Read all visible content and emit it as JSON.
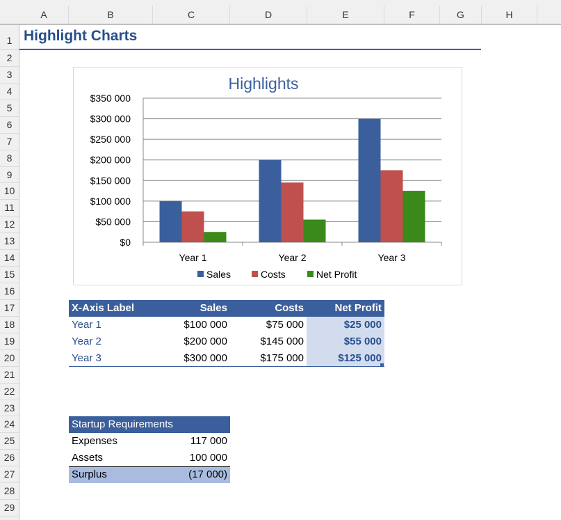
{
  "columns": [
    "A",
    "B",
    "C",
    "D",
    "E",
    "F",
    "G",
    "H"
  ],
  "rows": [
    "1",
    "2",
    "3",
    "4",
    "5",
    "6",
    "7",
    "8",
    "9",
    "10",
    "11",
    "12",
    "13",
    "14",
    "15",
    "16",
    "17",
    "18",
    "19",
    "20",
    "21",
    "22",
    "23",
    "24",
    "25",
    "26",
    "27",
    "28",
    "29"
  ],
  "title": "Highlight Charts",
  "chart_data": {
    "type": "bar",
    "title": "Highlights",
    "categories": [
      "Year 1",
      "Year 2",
      "Year 3"
    ],
    "series": [
      {
        "name": "Sales",
        "values": [
          100000,
          200000,
          300000
        ],
        "color": "#3a5f9c"
      },
      {
        "name": "Costs",
        "values": [
          75000,
          145000,
          175000
        ],
        "color": "#c0504d"
      },
      {
        "name": "Net Profit",
        "values": [
          25000,
          55000,
          125000
        ],
        "color": "#3a8a1a"
      }
    ],
    "ylim": [
      0,
      350000
    ],
    "yticks": [
      "$0",
      "$50 000",
      "$100 000",
      "$150 000",
      "$200 000",
      "$250 000",
      "$300 000",
      "$350 000"
    ],
    "legend": "bottom",
    "grid": true
  },
  "data_table": {
    "headers": [
      "X-Axis Label",
      "Sales",
      "Costs",
      "Net Profit"
    ],
    "rows": [
      [
        "Year 1",
        "$100 000",
        "$75 000",
        "$25 000"
      ],
      [
        "Year 2",
        "$200 000",
        "$145 000",
        "$55 000"
      ],
      [
        "Year 3",
        "$300 000",
        "$175 000",
        "$125 000"
      ]
    ]
  },
  "startup": {
    "header": "Startup Requirements",
    "rows": [
      [
        "Expenses",
        "117 000"
      ],
      [
        "Assets",
        "100 000"
      ],
      [
        "Surplus",
        "(17 000)"
      ]
    ]
  }
}
